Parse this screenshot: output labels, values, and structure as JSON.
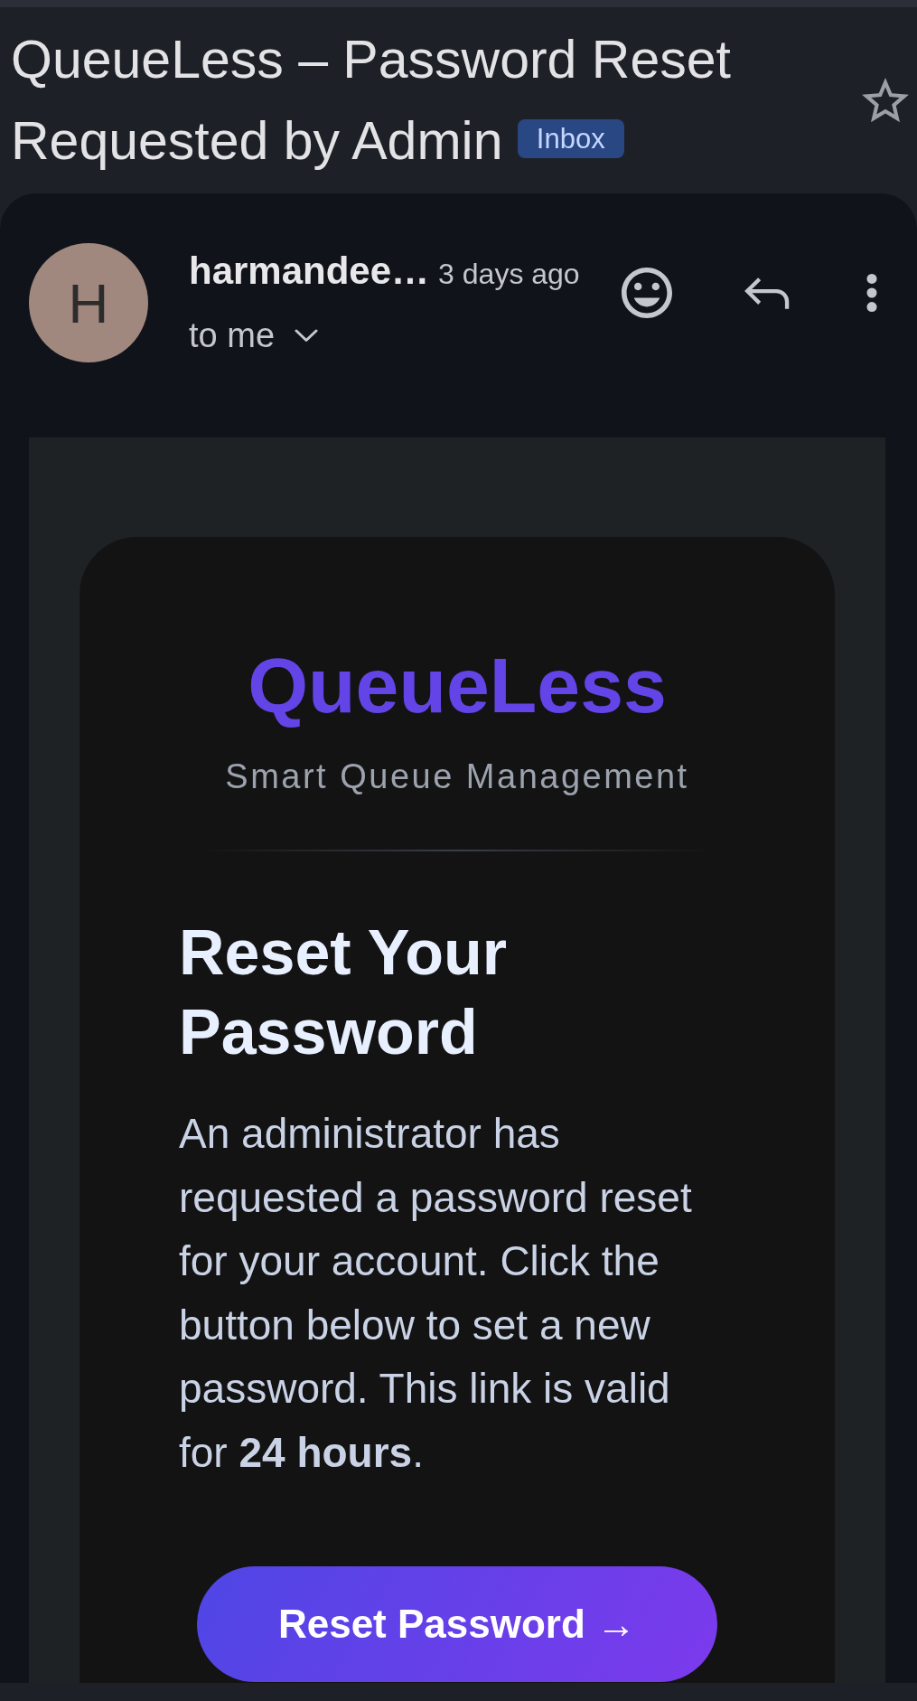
{
  "subject": {
    "title": "QueueLess – Password Reset Requested by Admin",
    "label": "Inbox",
    "starred": false
  },
  "sender": {
    "initial": "H",
    "name": "harmandee…",
    "time": "3 days ago",
    "recipient": "to me"
  },
  "email_body": {
    "brand": "QueueLess",
    "tagline": "Smart Queue Management",
    "heading": "Reset Your Password",
    "paragraph": "An administrator has requested a password reset for your account. Click the button below to set a new password. This link is valid for **24 hours**.",
    "button": "Reset Password →"
  }
}
